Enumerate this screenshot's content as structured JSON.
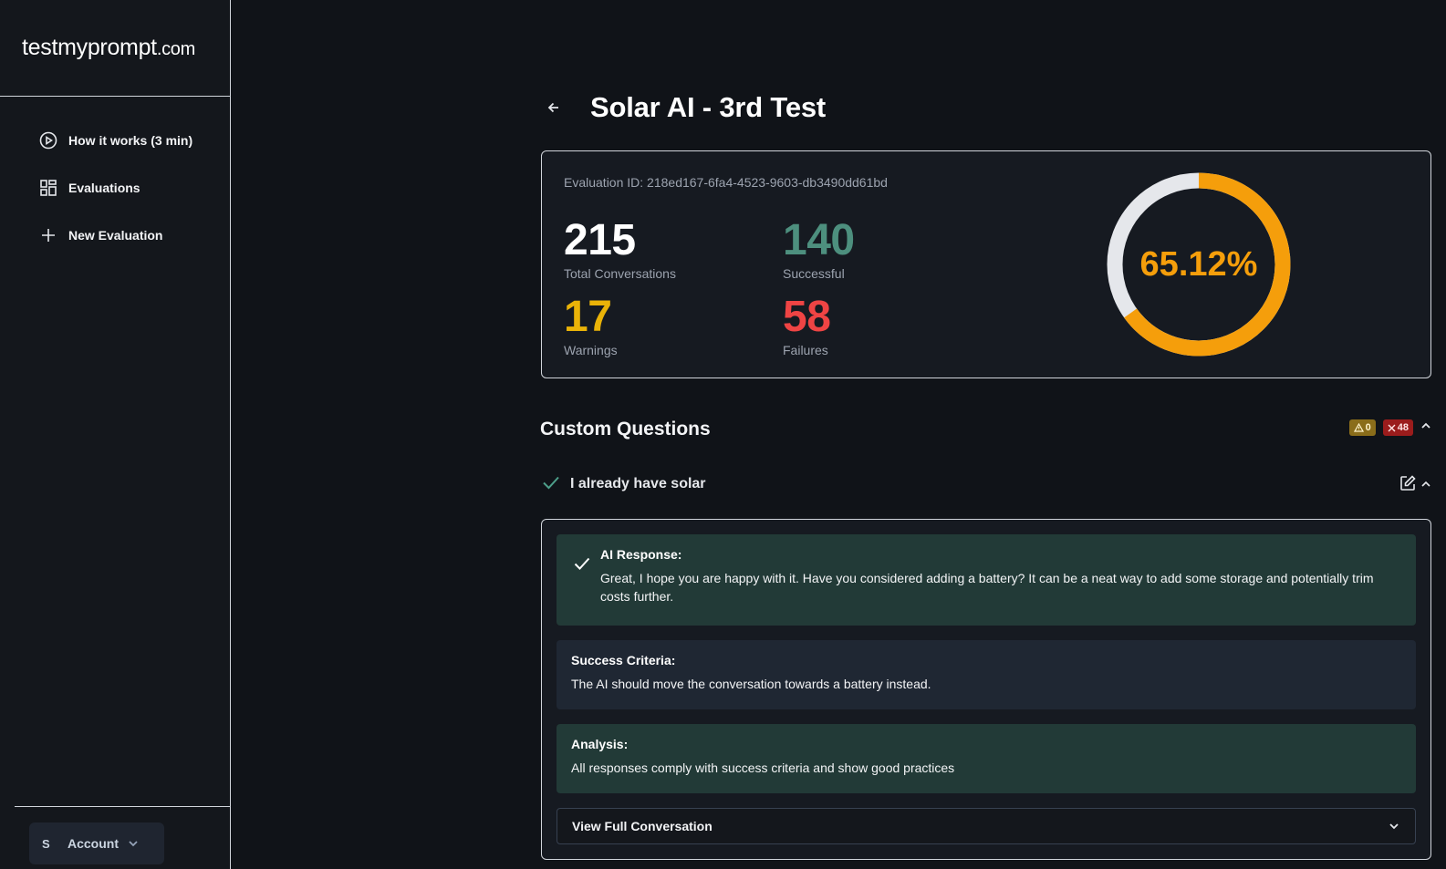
{
  "brand": {
    "name": "testmyprompt",
    "tld": ".com"
  },
  "nav": {
    "items": [
      {
        "label": "How it works (3 min)",
        "icon": "play-circle-icon"
      },
      {
        "label": "Evaluations",
        "icon": "grid-icon"
      },
      {
        "label": "New Evaluation",
        "icon": "plus-icon"
      }
    ]
  },
  "account": {
    "avatar": "S",
    "label": "Account"
  },
  "page": {
    "title": "Solar AI - 3rd Test"
  },
  "stats": {
    "evaluation_id": "Evaluation ID: 218ed167-6fa4-4523-9603-db3490dd61bd",
    "total": {
      "value": "215",
      "label": "Total Conversations"
    },
    "successful": {
      "value": "140",
      "label": "Successful"
    },
    "warnings": {
      "value": "17",
      "label": "Warnings"
    },
    "failures": {
      "value": "58",
      "label": "Failures"
    },
    "success_rate": {
      "text": "65.12%",
      "fraction": 0.6512
    },
    "colors": {
      "ring": "#f59e0b",
      "track": "#e5e7eb"
    }
  },
  "custom_questions": {
    "title": "Custom Questions",
    "warn_count": "0",
    "fail_count": "48"
  },
  "question": {
    "title": "I already have solar",
    "ai_response_label": "AI Response:",
    "ai_response_text": "Great, I hope you are happy with it. Have you considered adding a battery? It can be a neat way to add some storage and potentially trim costs further.",
    "criteria_label": "Success Criteria:",
    "criteria_text": "The AI should move the conversation towards a battery instead.",
    "analysis_label": "Analysis:",
    "analysis_text": "All responses comply with success criteria and show good practices",
    "view_conversation_label": "View Full Conversation"
  }
}
